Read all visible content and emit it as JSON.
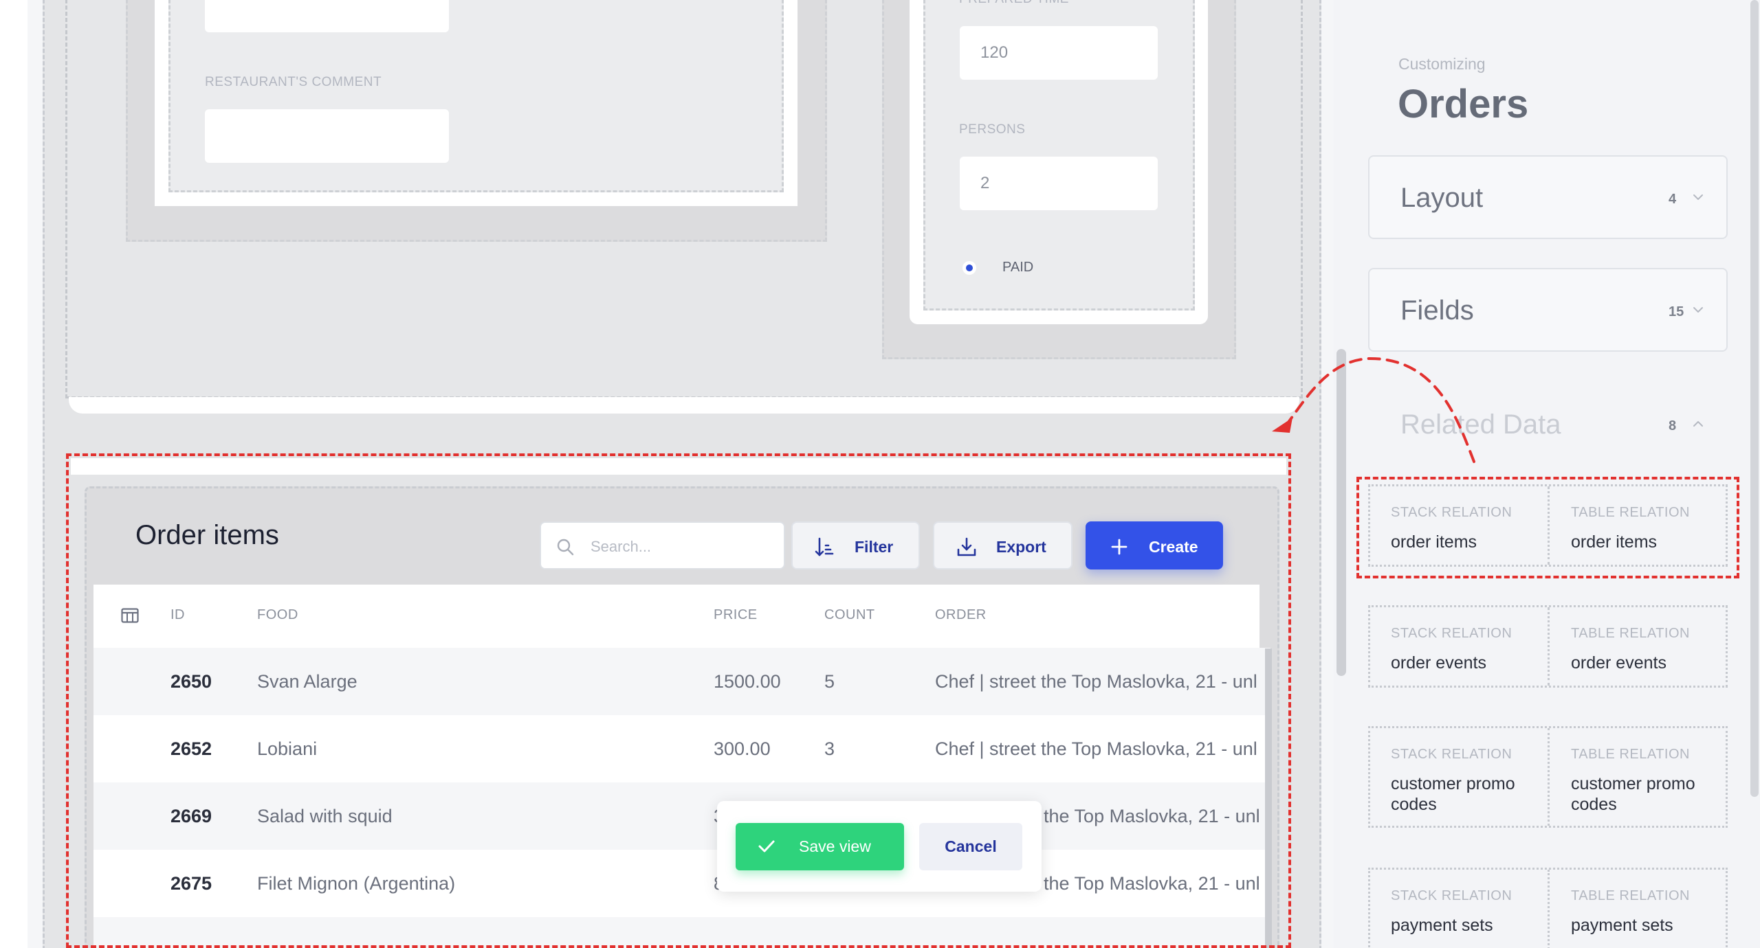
{
  "form": {
    "restaurant_comment_label": "RESTAURANT'S COMMENT",
    "prepared_time_label": "PREPARED TIME",
    "prepared_time_value": "120",
    "persons_label": "PERSONS",
    "persons_value": "2",
    "paid_label": "PAID"
  },
  "order_items": {
    "title": "Order items",
    "search_placeholder": "Search...",
    "filter_label": "Filter",
    "export_label": "Export",
    "create_label": "Create",
    "columns": [
      "ID",
      "FOOD",
      "PRICE",
      "COUNT",
      "ORDER"
    ],
    "rows": [
      {
        "id": "2650",
        "food": "Svan Alarge",
        "price": "1500.00",
        "count": "5",
        "order": "Chef | street the Top Maslovka, 21 - unl"
      },
      {
        "id": "2652",
        "food": "Lobiani",
        "price": "300.00",
        "count": "3",
        "order": "Chef | street the Top Maslovka, 21 - unl"
      },
      {
        "id": "2669",
        "food": "Salad with squid",
        "price": "3",
        "count": "",
        "order": "the Top Maslovka, 21 - unl"
      },
      {
        "id": "2675",
        "food": "Filet Mignon (Argentina)",
        "price": "8",
        "count": "",
        "order": "the Top Maslovka, 21 - unl"
      }
    ],
    "save_view_label": "Save view",
    "cancel_label": "Cancel"
  },
  "sidebar": {
    "subtitle": "Customizing",
    "title": "Orders",
    "sections": [
      {
        "label": "Layout",
        "count": "4"
      },
      {
        "label": "Fields",
        "count": "15"
      },
      {
        "label": "Related Data",
        "count": "8"
      }
    ],
    "relations": [
      {
        "stack_type": "STACK RELATION",
        "stack_name": "order items",
        "table_type": "TABLE RELATION",
        "table_name": "order items"
      },
      {
        "stack_type": "STACK RELATION",
        "stack_name": "order events",
        "table_type": "TABLE RELATION",
        "table_name": "order events"
      },
      {
        "stack_type": "STACK RELATION",
        "stack_name": "customer promo codes",
        "table_type": "TABLE RELATION",
        "table_name": "customer promo codes"
      },
      {
        "stack_type": "STACK RELATION",
        "stack_name": "payment sets",
        "table_type": "TABLE RELATION",
        "table_name": "payment sets"
      }
    ]
  },
  "colors": {
    "accent": "#3352e8",
    "success": "#2ed37c",
    "highlight": "#e2312f"
  }
}
